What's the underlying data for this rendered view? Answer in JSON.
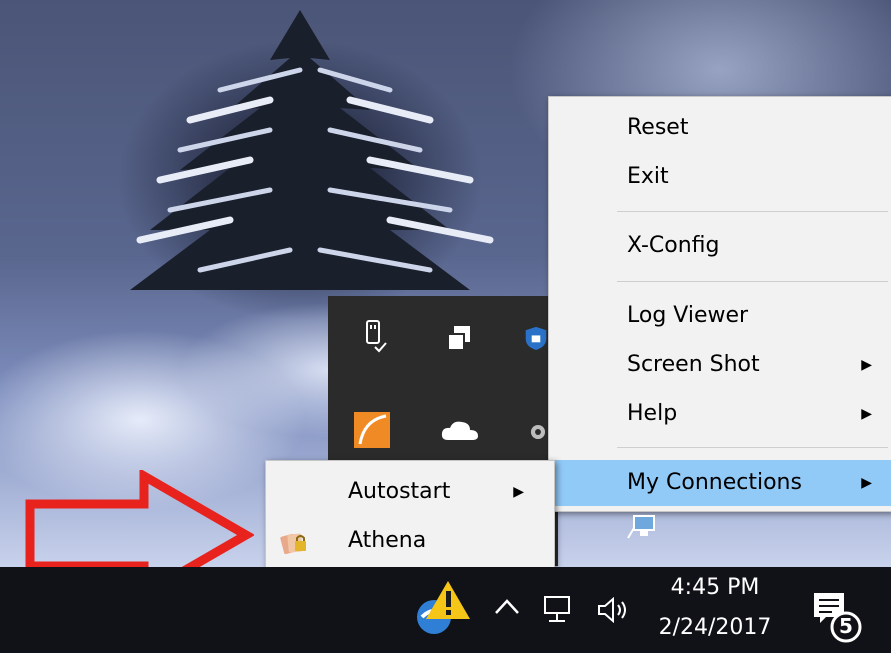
{
  "context_menu": {
    "items": [
      {
        "label": "Reset"
      },
      {
        "label": "Exit"
      },
      {
        "label": "X-Config"
      },
      {
        "label": "Log Viewer"
      },
      {
        "label": "Screen Shot",
        "submenu": true
      },
      {
        "label": "Help",
        "submenu": true
      },
      {
        "label": "My Connections",
        "submenu": true,
        "highlighted": true
      }
    ],
    "highlight_color": "#91c9f7"
  },
  "submenu": {
    "items": [
      {
        "label": "Autostart",
        "submenu": true
      },
      {
        "label": "Athena",
        "icon": "athena-app-icon"
      }
    ]
  },
  "tray_overflow_icons": [
    "usb-eject-icon",
    "copy-windows-icon",
    "shield-icon",
    "orange-app-icon",
    "onedrive-cloud-icon",
    "gear-icon",
    "network-monitor-icon"
  ],
  "taskbar": {
    "clock_time": "4:45 PM",
    "clock_date": "2/24/2017",
    "notification_count": "5",
    "tray_icons": [
      "update-warning-icon",
      "chevron-up-icon",
      "network-icon",
      "volume-icon",
      "action-center-icon"
    ]
  },
  "annotation_arrow_color": "#e8231e"
}
